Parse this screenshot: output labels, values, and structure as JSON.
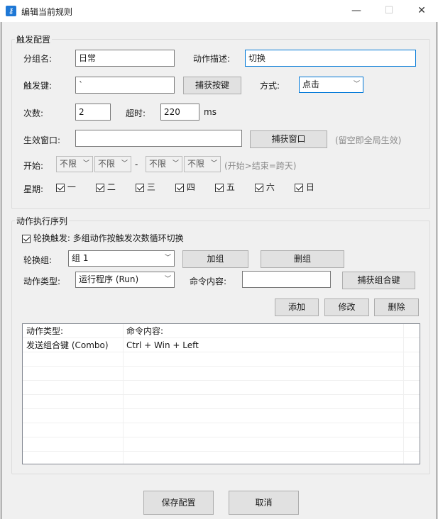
{
  "window": {
    "title": "编辑当前规则",
    "minimize": "—",
    "maximize": "☐",
    "close": "✕"
  },
  "trigger": {
    "section_title": "触发配置",
    "group_name_label": "分组名:",
    "group_name_value": "日常",
    "action_desc_label": "动作描述:",
    "action_desc_value": "切换",
    "key_label": "触发键:",
    "key_value": "`",
    "capture_key_button": "捕获按键",
    "mode_label": "方式:",
    "mode_value": "点击",
    "count_label": "次数:",
    "count_value": "2",
    "timeout_label": "超时:",
    "timeout_value": "220",
    "timeout_unit": "ms",
    "window_label": "生效窗口:",
    "window_value": "",
    "capture_window_button": "捕获窗口",
    "window_hint": "(留空即全局生效)",
    "start_label": "开始:",
    "start_a": "不限",
    "start_b": "不限",
    "range_dash": "-",
    "end_a": "不限",
    "end_b": "不限",
    "range_hint": "(开始>结束=跨天)",
    "week_label": "星期:",
    "days": [
      "一",
      "二",
      "三",
      "四",
      "五",
      "六",
      "日"
    ]
  },
  "sequence": {
    "section_title": "动作执行序列",
    "rotate_label": "轮换触发: 多组动作按触发次数循环切换",
    "rotate_group_label": "轮换组:",
    "rotate_group_value": "组 1",
    "add_group_button": "加组",
    "delete_group_button": "删组",
    "action_type_label": "动作类型:",
    "action_type_value": "运行程序 (Run)",
    "command_label": "命令内容:",
    "command_value": "",
    "capture_combo_button": "捕获组合键",
    "add_button": "添加",
    "modify_button": "修改",
    "delete_button": "删除",
    "list": {
      "columns": [
        "动作类型:",
        "命令内容:"
      ],
      "rows": [
        {
          "type": "发送组合键 (Combo)",
          "command": "Ctrl + Win + Left"
        }
      ]
    }
  },
  "footer": {
    "save_button": "保存配置",
    "cancel_button": "取消"
  },
  "colors": {
    "accent": "#0078d7",
    "titlebar": "#ffffff",
    "background": "#f0f0f0"
  }
}
